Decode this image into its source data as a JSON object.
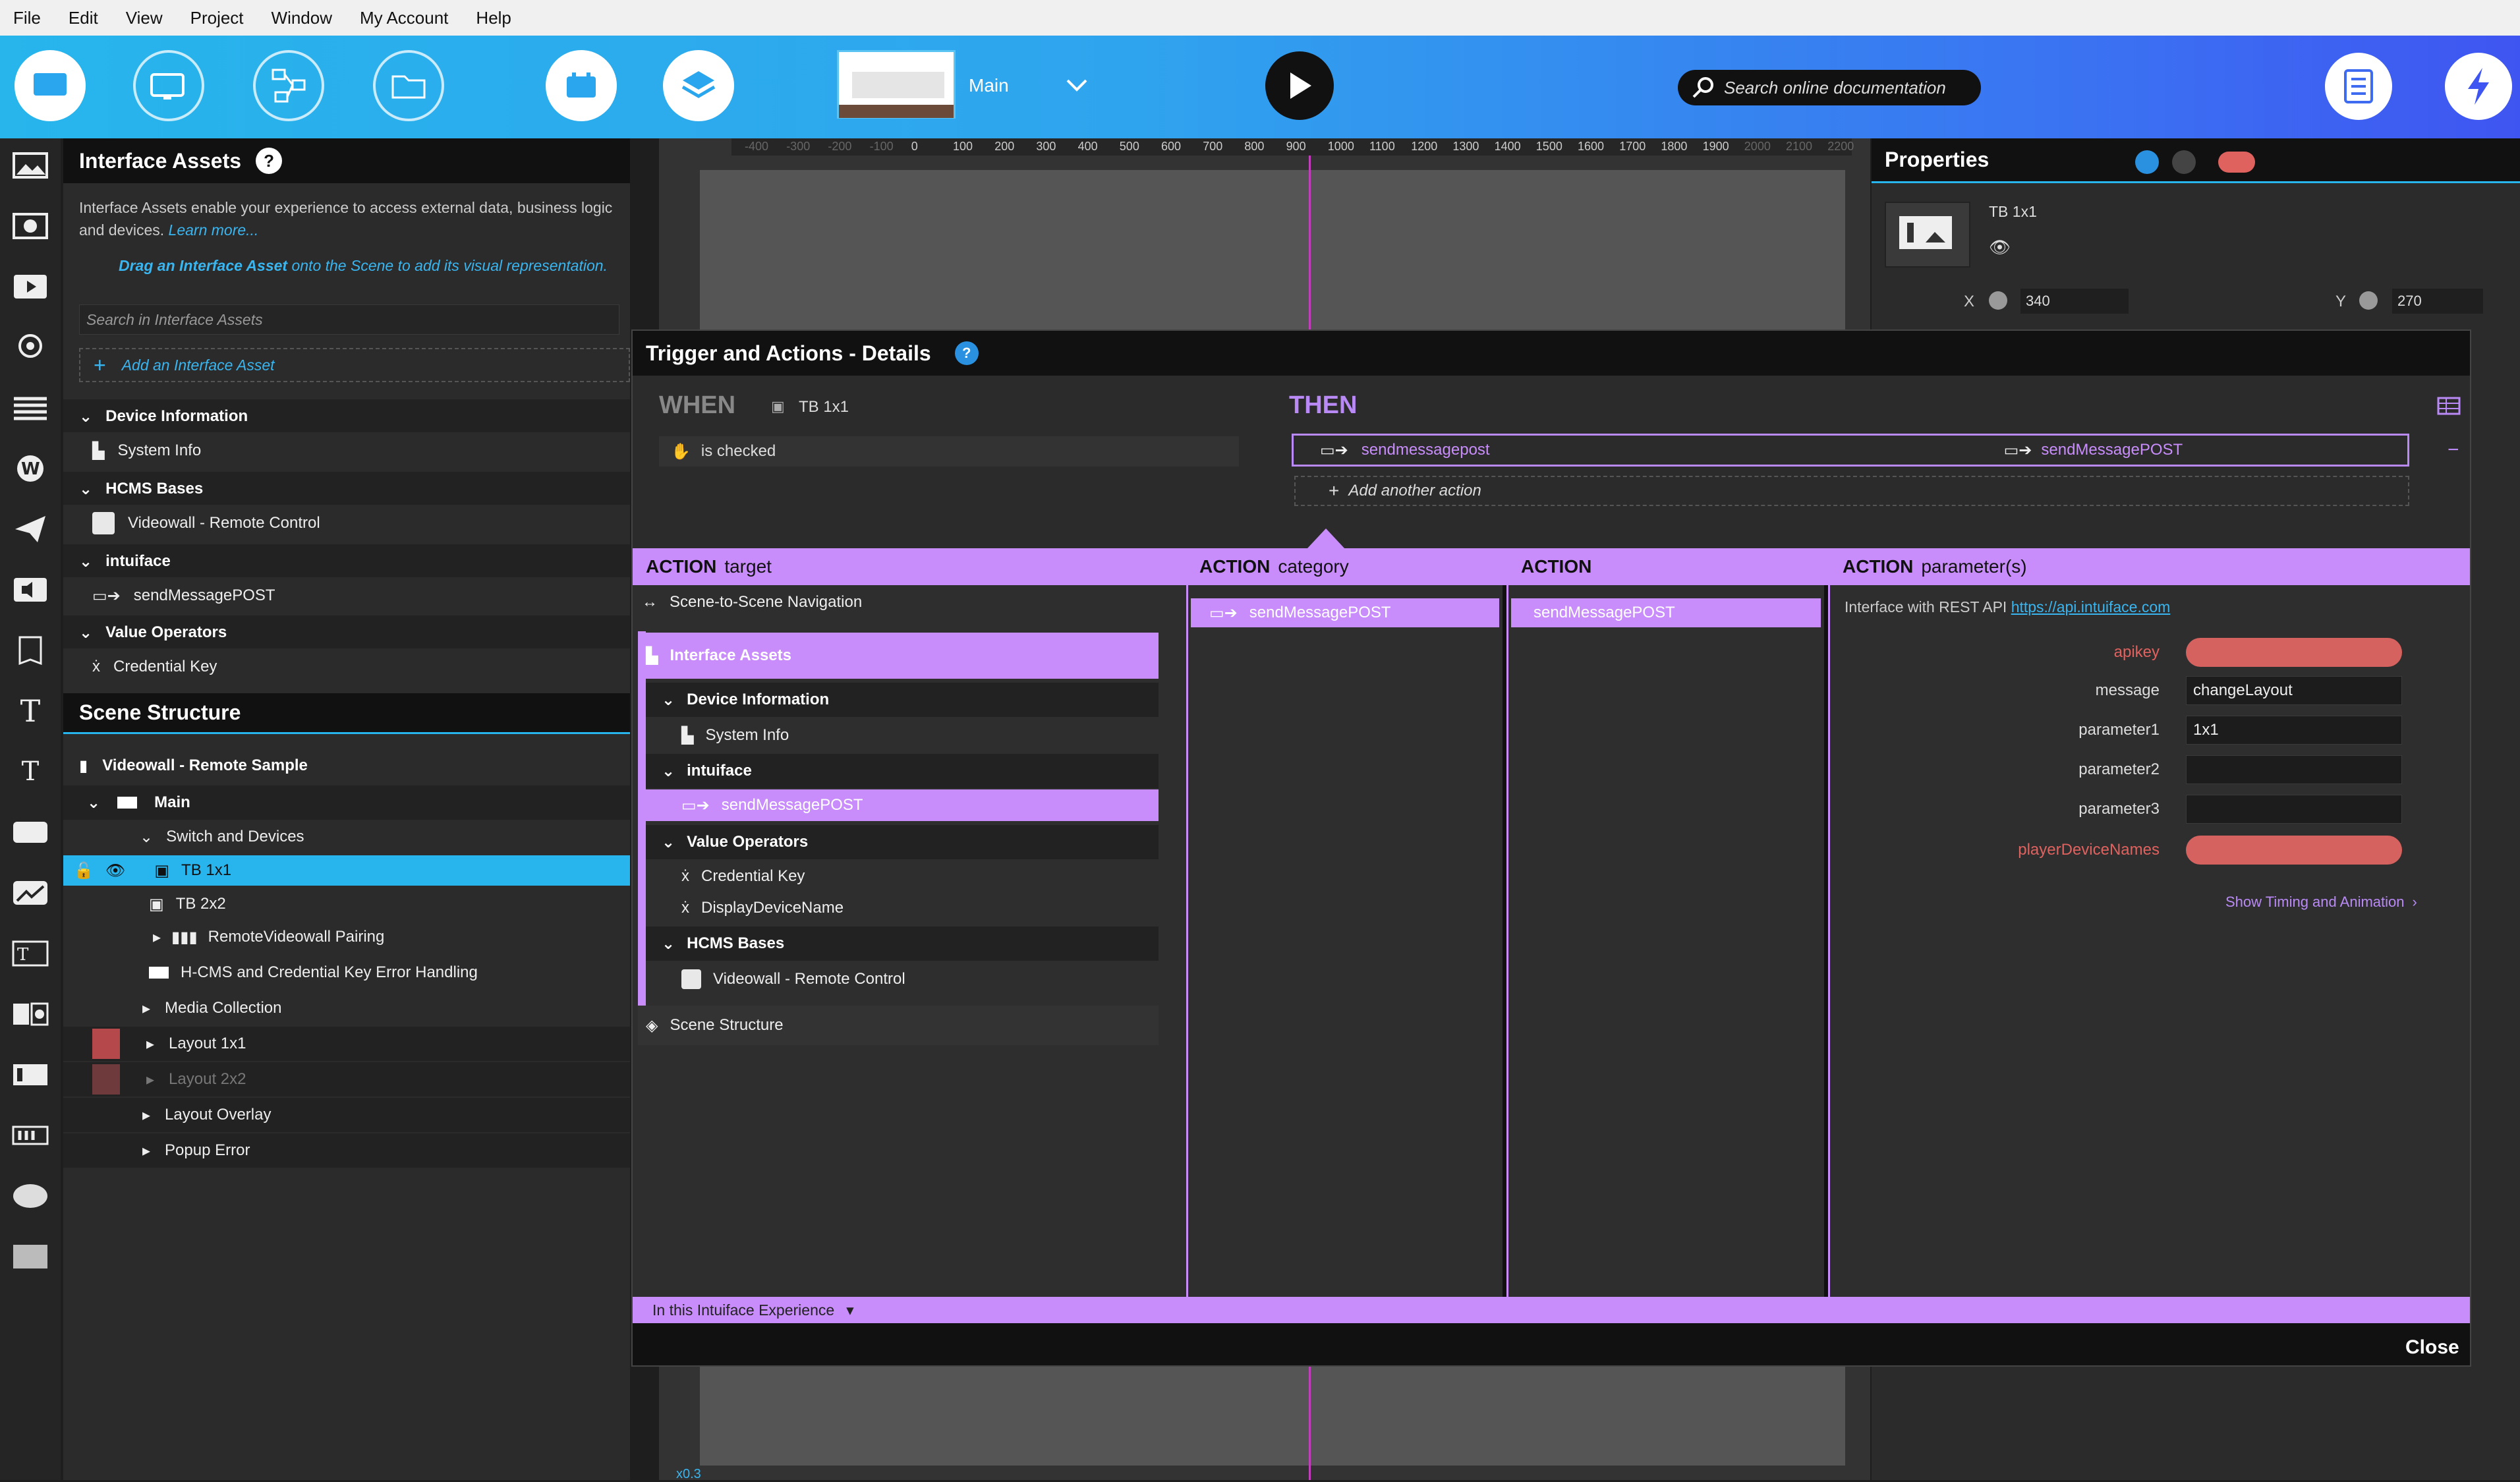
{
  "menu": [
    "File",
    "Edit",
    "View",
    "Project",
    "Window",
    "My Account",
    "Help"
  ],
  "toolbar": {
    "scene_name": "Main",
    "search_placeholder": "Search online documentation"
  },
  "left_panel": {
    "title": "Interface Assets",
    "description": "Interface Assets enable your experience to access external data, business logic and devices.",
    "learn_more": "Learn more...",
    "drag_hint_bold": "Drag an Interface Asset",
    "drag_hint_rest": "onto the Scene to add its visual representation.",
    "search_placeholder": "Search in Interface Assets",
    "add_label": "Add an Interface Asset",
    "groups": [
      {
        "header": "Device Information",
        "item": "System Info"
      },
      {
        "header": "HCMS Bases",
        "item": "Videowall - Remote Control"
      },
      {
        "header": "intuiface",
        "item": "sendMessagePOST"
      },
      {
        "header": "Value Operators",
        "item": "Credential Key"
      }
    ]
  },
  "scene_structure": {
    "title": "Scene Structure",
    "root": "Videowall - Remote Sample",
    "items": [
      {
        "label": "Main"
      },
      {
        "label": "Switch and Devices"
      },
      {
        "label": "TB 1x1"
      },
      {
        "label": "TB 2x2"
      },
      {
        "label": "RemoteVideowall Pairing"
      },
      {
        "label": "H-CMS and Credential Key Error Handling"
      },
      {
        "label": "Media Collection"
      },
      {
        "label": "Layout 1x1"
      },
      {
        "label": "Layout 2x2"
      },
      {
        "label": "Layout Overlay"
      },
      {
        "label": "Popup Error"
      }
    ]
  },
  "ruler_ticks": [
    "-400",
    "-300",
    "-200",
    "-100",
    "0",
    "100",
    "200",
    "300",
    "400",
    "500",
    "600",
    "700",
    "800",
    "900",
    "1000",
    "1100",
    "1200",
    "1300",
    "1400",
    "1500",
    "1600",
    "1700",
    "1800",
    "1900",
    "2000",
    "2100",
    "2200"
  ],
  "properties": {
    "title": "Properties",
    "item_name": "TB 1x1",
    "x_label": "X",
    "x_value": "340",
    "y_label": "Y",
    "y_value": "270"
  },
  "modal": {
    "title": "Trigger and Actions - Details",
    "when_label": "WHEN",
    "when_source": "TB 1x1",
    "trigger": "is checked",
    "then_label": "THEN",
    "action_name": "sendmessagepost",
    "action_target": "sendMessagePOST",
    "add_action": "Add another action",
    "col_target": {
      "bold": "ACTION",
      "rest": "target"
    },
    "col_category": {
      "bold": "ACTION",
      "rest": "category"
    },
    "col_action": {
      "bold": "ACTION",
      "rest": ""
    },
    "col_params": {
      "bold": "ACTION",
      "rest": "parameter(s)"
    },
    "targets": {
      "nav": "Scene-to-Scene Navigation",
      "interface_assets": "Interface Assets",
      "device_information": "Device Information",
      "system_info": "System Info",
      "intuiface": "intuiface",
      "sendmessagepost": "sendMessagePOST",
      "value_operators": "Value Operators",
      "credential_key": "Credential Key",
      "display_device_name": "DisplayDeviceName",
      "hcms_bases": "HCMS Bases",
      "videowall": "Videowall - Remote Control",
      "scene_structure": "Scene Structure"
    },
    "category_selected": "sendMessagePOST",
    "action_selected": "sendMessagePOST",
    "params_intro": "Interface with REST API",
    "params_link": "https://api.intuiface.com",
    "params": [
      {
        "label": "apikey",
        "value": "",
        "required": true
      },
      {
        "label": "message",
        "value": "changeLayout",
        "required": false
      },
      {
        "label": "parameter1",
        "value": "1x1",
        "required": false
      },
      {
        "label": "parameter2",
        "value": "",
        "required": false
      },
      {
        "label": "parameter3",
        "value": "",
        "required": false
      },
      {
        "label": "playerDeviceNames",
        "value": "",
        "required": true
      }
    ],
    "show_timing": "Show Timing and Animation",
    "footer_scope": "In this Intuiface Experience",
    "close": "Close"
  },
  "colors": {
    "accent_lavender": "#c88dfb",
    "selection_blue": "#28b4ec",
    "required_red": "#d6625f",
    "then_purple": "#b98af5"
  },
  "bottom_bar": {
    "zoom": "x0.3"
  }
}
